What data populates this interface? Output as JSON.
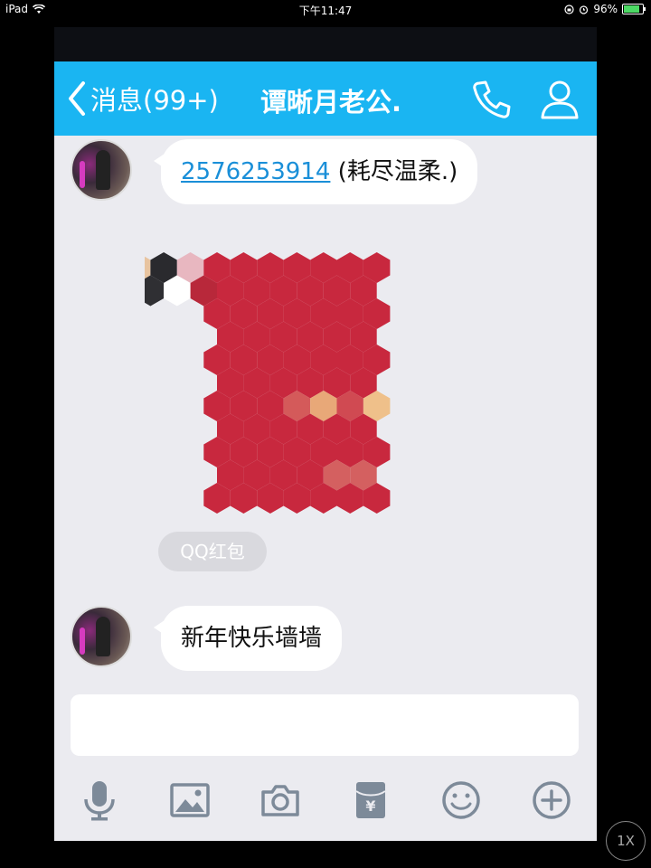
{
  "status_bar": {
    "device": "iPad",
    "time": "下午11:47",
    "battery_text": "96%",
    "battery_level": 0.96,
    "battery_color": "#4cd964"
  },
  "nav": {
    "back_label": "消息(99+)",
    "title": "谭晰月老公.",
    "bar_color": "#1ab5f2",
    "icons": [
      "chevron-left-icon",
      "phone-icon",
      "person-icon"
    ]
  },
  "messages": [
    {
      "type": "text",
      "link_text": "2576253914",
      "suffix_text": " (耗尽温柔.)"
    },
    {
      "type": "red_packet",
      "label": "QQ红包",
      "packet_color": "#c8283e"
    },
    {
      "type": "text",
      "text": "新年快乐墙墙"
    }
  ],
  "input": {
    "placeholder": ""
  },
  "toolbar": {
    "icons": [
      "microphone-icon",
      "image-icon",
      "camera-icon",
      "red-packet-icon",
      "emoji-icon",
      "add-icon"
    ]
  },
  "zoom_badge": "1X"
}
